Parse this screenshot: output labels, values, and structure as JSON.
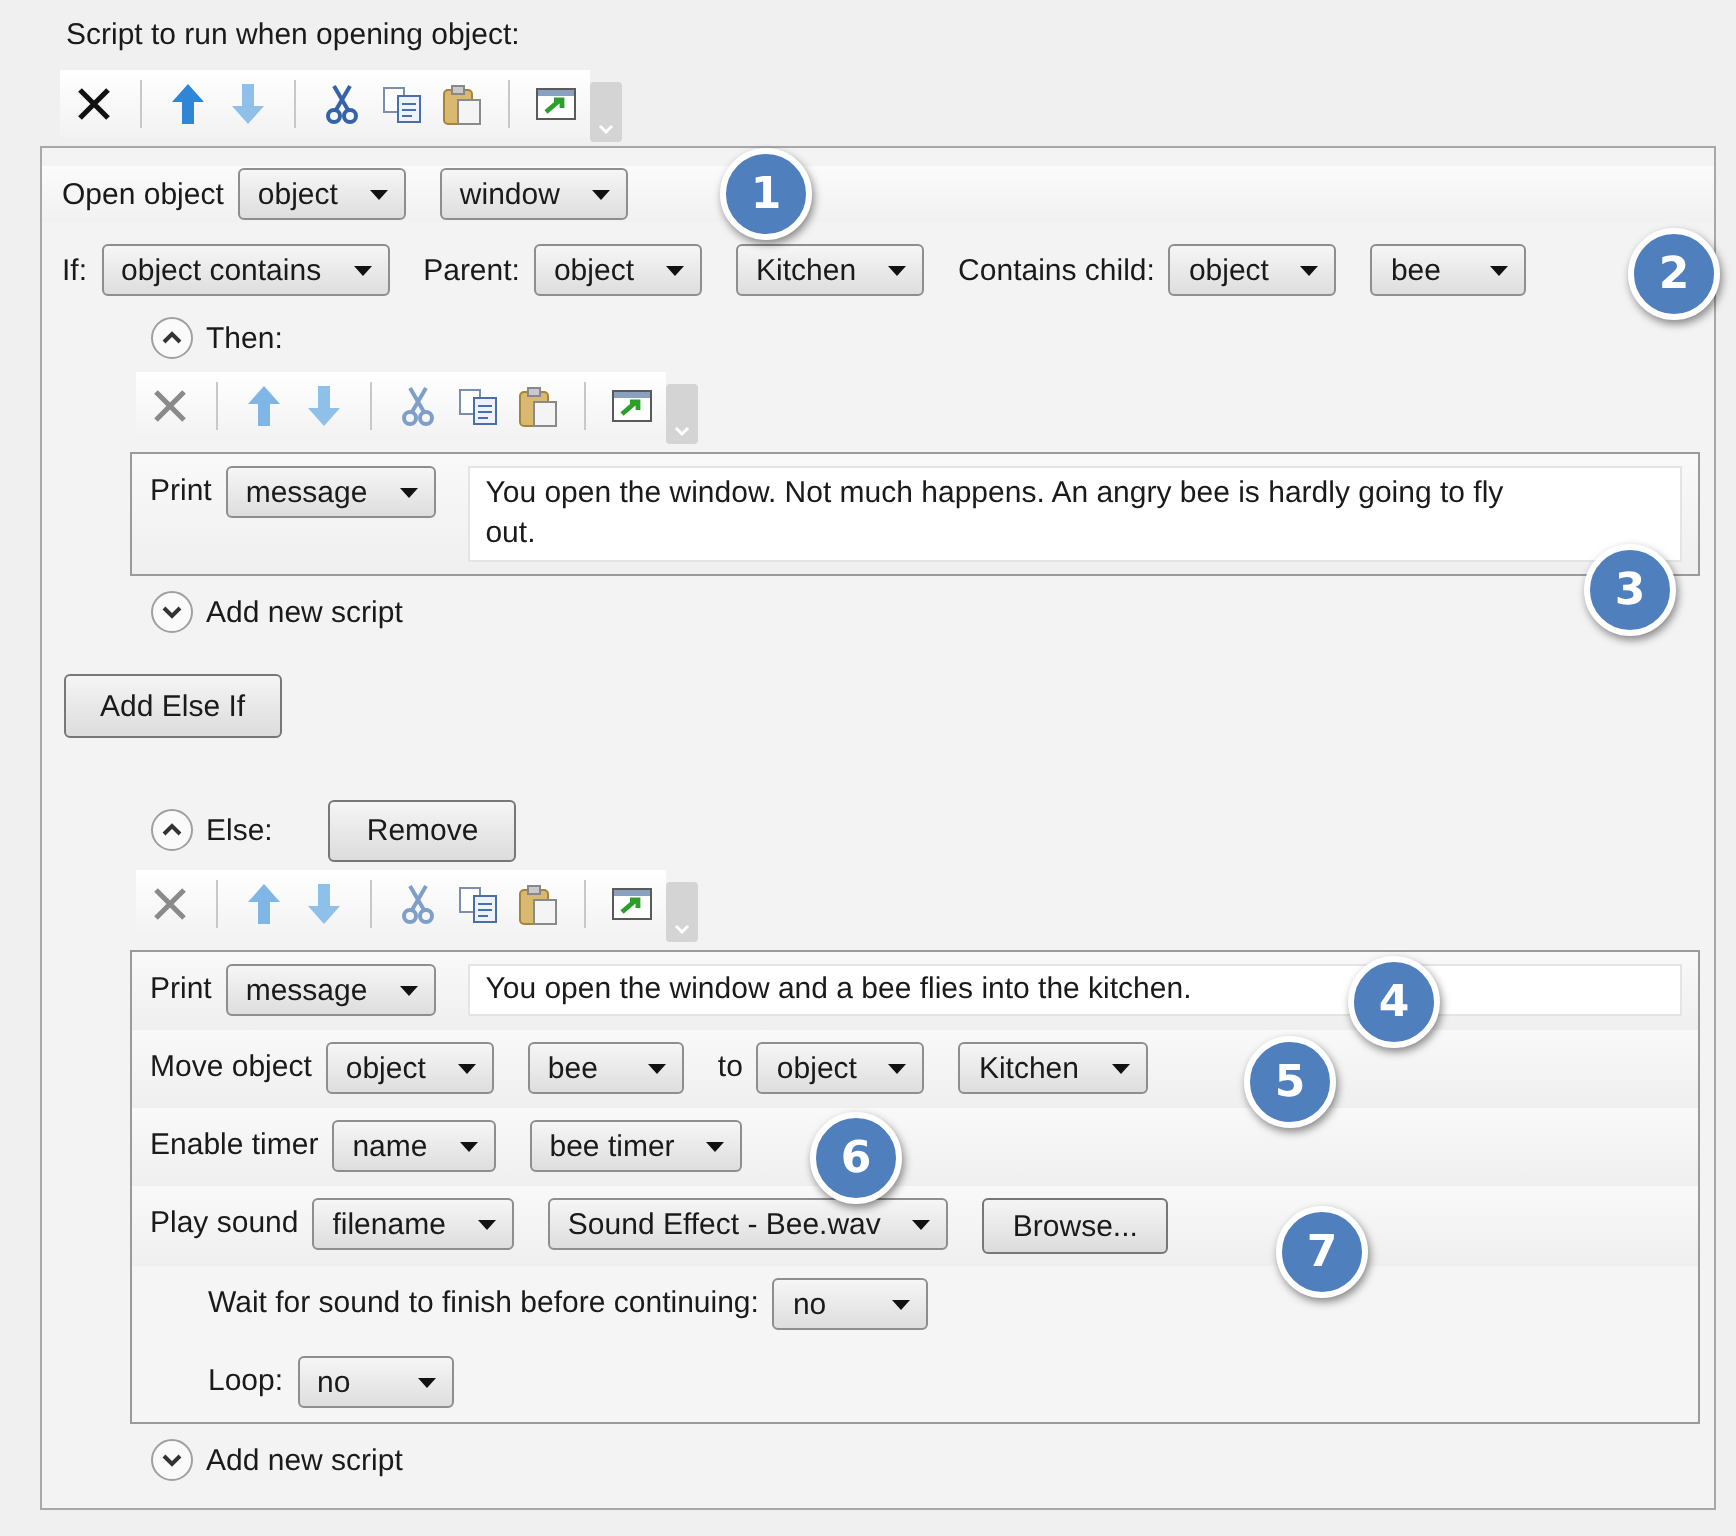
{
  "script_label": "Script to run when opening object:",
  "toolbar": {
    "disabled": false
  },
  "open_row": {
    "parts": [
      {
        "kind": "label",
        "text": "Open object"
      },
      {
        "kind": "dropdown",
        "text": "object"
      },
      {
        "kind": "dropdown",
        "text": "window"
      }
    ]
  },
  "if_row": {
    "parts": [
      {
        "kind": "label",
        "text": "If:"
      },
      {
        "kind": "dropdown",
        "text": "object contains"
      },
      {
        "kind": "label",
        "text": "Parent:"
      },
      {
        "kind": "dropdown",
        "text": "object"
      },
      {
        "kind": "dropdown",
        "text": "Kitchen"
      },
      {
        "kind": "label",
        "text": "Contains child:"
      },
      {
        "kind": "dropdown",
        "text": "object"
      },
      {
        "kind": "dropdown",
        "text": "bee"
      }
    ]
  },
  "then": {
    "label": "Then:",
    "expanded": true,
    "toolbar": {
      "disabled": true
    },
    "scripts": [
      {
        "parts": [
          {
            "kind": "label",
            "text": "Print"
          },
          {
            "kind": "dropdown",
            "text": "message"
          },
          {
            "kind": "textarea",
            "text": "You open the window. Not much happens. An angry bee is hardly going to fly out."
          }
        ]
      }
    ],
    "add_script": "Add new script"
  },
  "add_else_if": "Add Else If",
  "else": {
    "label": "Else:",
    "expanded": true,
    "remove": "Remove",
    "toolbar": {
      "disabled": true
    },
    "scripts": [
      {
        "parts": [
          {
            "kind": "label",
            "text": "Print"
          },
          {
            "kind": "dropdown",
            "text": "message"
          },
          {
            "kind": "field",
            "text": "You open the window and a bee flies into the kitchen."
          }
        ]
      },
      {
        "parts": [
          {
            "kind": "label",
            "text": "Move object"
          },
          {
            "kind": "dropdown",
            "text": "object"
          },
          {
            "kind": "dropdown",
            "text": "bee"
          },
          {
            "kind": "label",
            "text": "to"
          },
          {
            "kind": "dropdown",
            "text": "object"
          },
          {
            "kind": "dropdown",
            "text": "Kitchen"
          }
        ]
      },
      {
        "parts": [
          {
            "kind": "label",
            "text": "Enable timer"
          },
          {
            "kind": "dropdown",
            "text": "name"
          },
          {
            "kind": "dropdown",
            "text": "bee timer"
          }
        ]
      },
      {
        "parts": [
          {
            "kind": "label",
            "text": "Play sound"
          },
          {
            "kind": "dropdown",
            "text": "filename"
          },
          {
            "kind": "dropdown",
            "text": "Sound Effect - Bee.wav"
          },
          {
            "kind": "button",
            "text": "Browse..."
          }
        ],
        "children": [
          {
            "parts": [
              {
                "kind": "label",
                "text": "Wait for sound to finish before continuing:"
              },
              {
                "kind": "dropdown",
                "text": "no"
              }
            ]
          },
          {
            "parts": [
              {
                "kind": "label",
                "text": "Loop:"
              },
              {
                "kind": "dropdown",
                "text": "no"
              }
            ]
          }
        ]
      }
    ],
    "add_script": "Add new script"
  },
  "callouts": [
    "1",
    "2",
    "3",
    "4",
    "5",
    "6",
    "7"
  ]
}
